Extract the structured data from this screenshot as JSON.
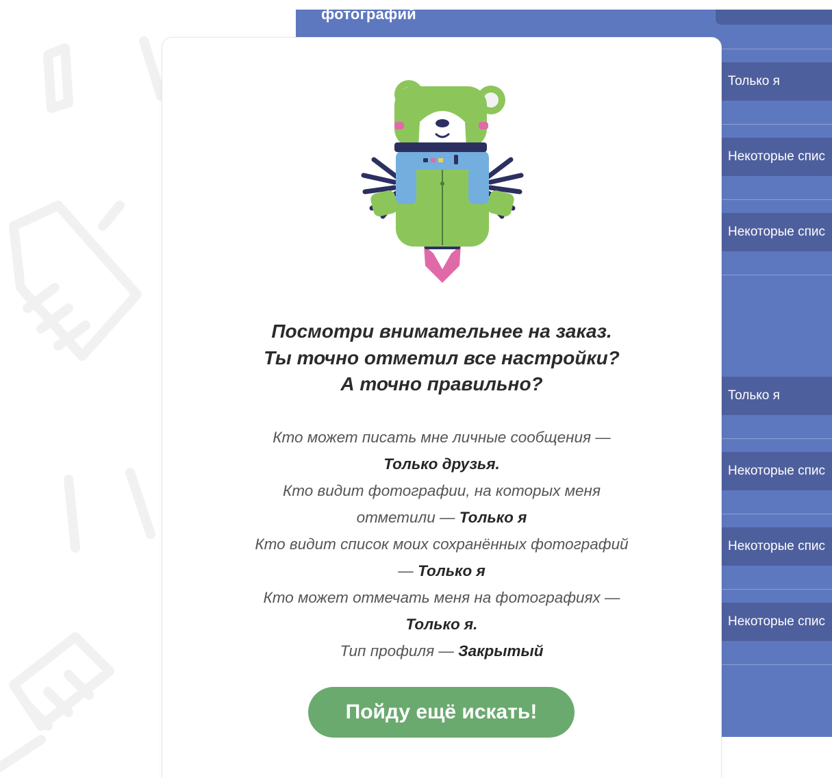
{
  "background_page": {
    "top_label": "фотографий",
    "options": [
      "Только я",
      "Некоторые спис",
      "Некоторые спис",
      "Только я",
      "Некоторые спис",
      "Некоторые спис",
      "Некоторые спис"
    ],
    "panel_color": "#5e78c0",
    "option_bar_color": "#4e5f9d"
  },
  "modal": {
    "mascot": "bear-rocket-illustration",
    "heading": [
      "Посмотри внимательнее на заказ.",
      "Ты точно отметил все настройки?",
      "А точно правильно?"
    ],
    "settings": [
      {
        "question": "Кто может писать мне личные сообщения —",
        "answer": "Только друзья."
      },
      {
        "question_line1": "Кто видит фотографии, на которых меня",
        "question_line2": "отметили —",
        "answer": "Только я"
      },
      {
        "question": "Кто видит список моих сохранённых фотографий",
        "answer_prefix": "—",
        "answer": "Только я"
      },
      {
        "question": "Кто может отмечать меня на фотографиях —",
        "answer": "Только я."
      },
      {
        "question": "Тип профиля —",
        "answer": "Закрытый"
      }
    ],
    "button_label": "Пойду ещё искать!",
    "button_color": "#6aaa6f"
  }
}
